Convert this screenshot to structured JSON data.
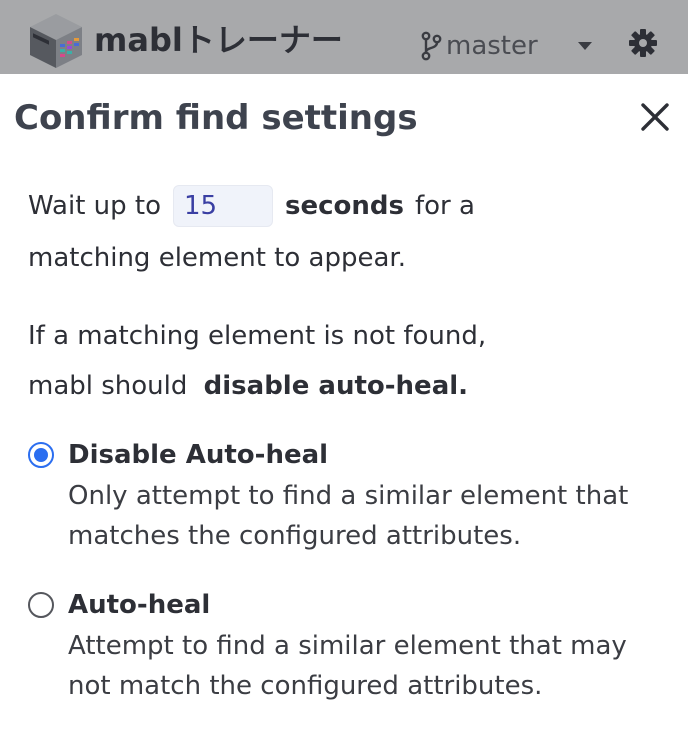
{
  "header": {
    "app_title": "mablトレーナー",
    "branch": "master",
    "logo_icon": "mabl-cube-logo-icon",
    "branch_icon": "git-branch-icon",
    "dropdown_icon": "chevron-down-icon",
    "settings_icon": "gear-icon"
  },
  "dialog": {
    "title": "Confirm find settings",
    "close_icon": "close-icon",
    "wait": {
      "prefix": "Wait up to",
      "value": "15",
      "unit": "seconds",
      "suffix": "for a",
      "line2": "matching element to appear."
    },
    "fallback": {
      "line1": "If a matching element is not found,",
      "prefix": "mabl should",
      "action": "disable auto-heal."
    },
    "options": [
      {
        "label": "Disable Auto-heal",
        "desc_line1": "Only attempt to find a similar element that",
        "desc_line2": "matches the configured attributes.",
        "selected": true
      },
      {
        "label": "Auto-heal",
        "desc_line1": "Attempt to find a similar element that may",
        "desc_line2": "not match the configured attributes.",
        "selected": false
      }
    ]
  },
  "colors": {
    "topbar": "#a8a9ab",
    "accent_radio": "#2b6ef0",
    "title_text": "#3e434e",
    "input_bg": "#f0f3fa",
    "input_text": "#3a3fa3"
  }
}
